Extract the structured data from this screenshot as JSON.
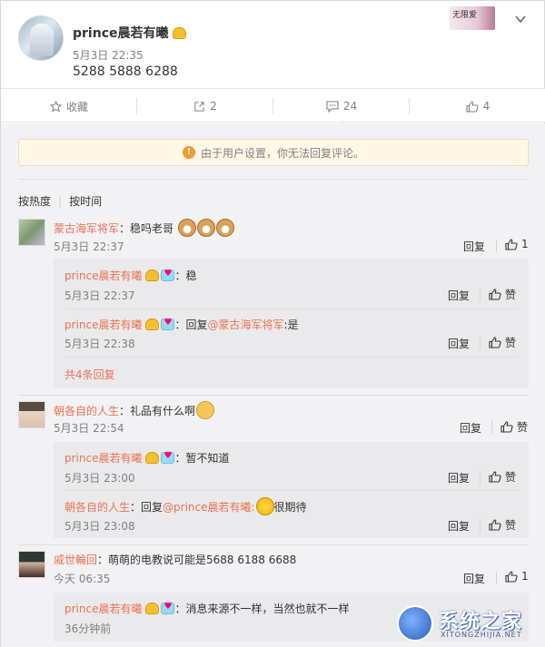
{
  "post": {
    "username": "prince晨若有曦",
    "time": "5月3日 22:35",
    "text": "5288 5888 6288"
  },
  "actions": {
    "favorite": "收藏",
    "share": "2",
    "comment": "24",
    "like": "4"
  },
  "notice": "由于用户设置，你无法回复评论。",
  "sort": {
    "hot": "按热度",
    "time": "按时间"
  },
  "comments": [
    {
      "name": "蒙古海军将军",
      "text": "：稳吗老哥",
      "time": "5月3日 22:37",
      "reply": "回复",
      "likes": "1",
      "subs": [
        {
          "name": "prince晨若有曦",
          "text": "：稳",
          "time": "5月3日 22:37",
          "reply": "回复",
          "like": "赞"
        },
        {
          "name": "prince晨若有曦",
          "text_prefix": "：回复",
          "mention": "@蒙古海军将军",
          "text": ":是",
          "time": "5月3日 22:38",
          "reply": "回复",
          "like": "赞"
        }
      ],
      "more": "共4条回复"
    },
    {
      "name": "朝各自的人生",
      "text": "：礼品有什么啊",
      "time": "5月3日 22:54",
      "reply": "回复",
      "likes": "赞",
      "subs": [
        {
          "name": "prince晨若有曦",
          "text": "：暂不知道",
          "time": "5月3日 23:00",
          "reply": "回复",
          "like": "赞"
        },
        {
          "name": "朝各自的人生",
          "text_prefix": "：回复",
          "mention": "@prince晨若有曦:",
          "text": "很期待",
          "time": "5月3日 23:08",
          "reply": "回复",
          "like": "赞"
        }
      ]
    },
    {
      "name": "戚世輪回",
      "text": "：萌萌的电教说可能是5688 6188 6688",
      "time": "今天 06:35",
      "reply": "回复",
      "likes": "1",
      "subs": [
        {
          "name": "prince晨若有曦",
          "text": "：消息来源不一样，当然也就不一样",
          "time": "36分钟前"
        }
      ]
    }
  ],
  "watermark": {
    "title": "系统之家",
    "url": "XITONGZHIJIA.NET"
  }
}
